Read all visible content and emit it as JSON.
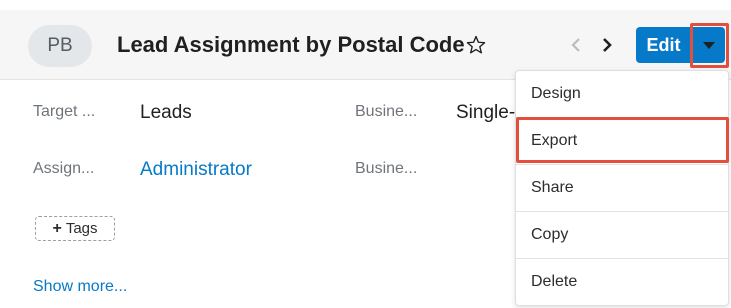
{
  "header": {
    "avatar_initials": "PB",
    "title": "Lead Assignment by Postal Code",
    "edit_label": "Edit",
    "icons": {
      "favorite": "star-outline-icon",
      "previous": "chevron-left-icon",
      "next": "chevron-right-icon",
      "actions": "caret-down-icon"
    }
  },
  "fields": {
    "target_label": "Target ...",
    "target_value": "Leads",
    "business_label_1": "Busine...",
    "business_value_1": "Single-",
    "assign_label": "Assign...",
    "assign_value": "Administrator",
    "business_label_2": "Busine..."
  },
  "tags": {
    "plus_glyph": "+",
    "label": "Tags"
  },
  "show_more_label": "Show more...",
  "dropdown": {
    "items": [
      {
        "label": "Design"
      },
      {
        "label": "Export",
        "highlighted": true
      },
      {
        "label": "Share"
      },
      {
        "label": "Copy"
      },
      {
        "label": "Delete"
      }
    ]
  },
  "colors": {
    "accent": "#0679c8",
    "highlight": "#e2503d",
    "header_background": "#f6f6f6"
  }
}
